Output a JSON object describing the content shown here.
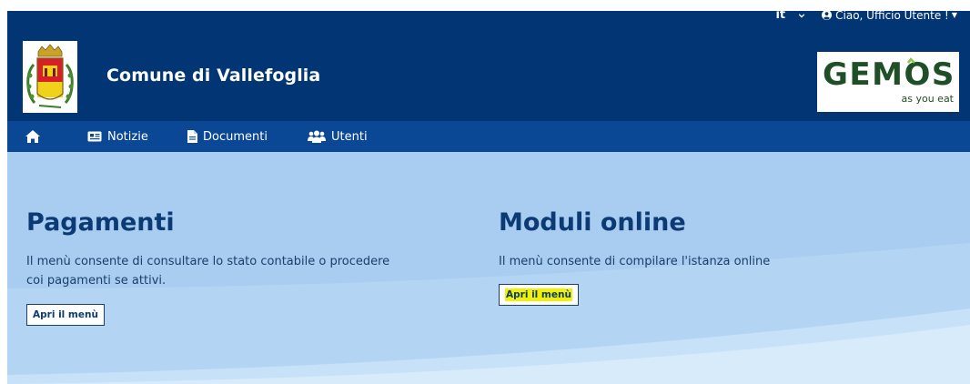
{
  "header": {
    "language": "it",
    "greeting": "Ciao, Ufficio Utente !",
    "municipality": "Comune di Vallefoglia",
    "brand_name": "GEMOS",
    "brand_slogan": "as you eat"
  },
  "nav": {
    "home_icon": "home-icon",
    "items": [
      {
        "label": "Notizie",
        "icon": "newspaper-icon"
      },
      {
        "label": "Documenti",
        "icon": "document-icon"
      },
      {
        "label": "Utenti",
        "icon": "users-icon"
      }
    ]
  },
  "sections": [
    {
      "title": "Pagamenti",
      "description": "Il menù consente di consultare lo stato contabile o procedere coi pagamenti se attivi.",
      "button_label": "Apri il menù"
    },
    {
      "title": "Moduli online",
      "description": "Il menù consente di compilare l'istanza online",
      "button_label": "Apri il menù"
    }
  ],
  "colors": {
    "header_bg": "#023573",
    "nav_bg": "#0a4794",
    "hero_bg": "#a8cdf0",
    "title_color": "#0b3a75",
    "highlight": "#f2f200",
    "brand_green": "#1f4f27"
  }
}
